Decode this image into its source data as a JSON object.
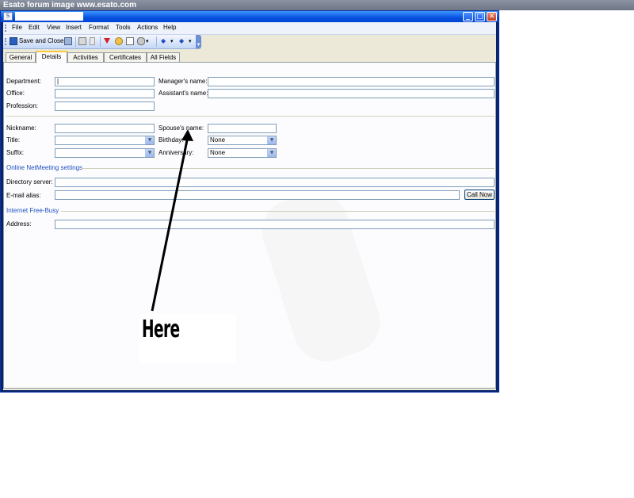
{
  "watermark": {
    "text": "Esato forum image www.esato.com"
  },
  "window": {
    "title_text": "",
    "controls": {
      "minimize": "_",
      "maximize": "□",
      "close": "✕"
    }
  },
  "menu": [
    "File",
    "Edit",
    "View",
    "Insert",
    "Format",
    "Tools",
    "Actions",
    "Help"
  ],
  "toolbar": {
    "save_close_label": "Save and Close"
  },
  "tabs": [
    "General",
    "Details",
    "Activities",
    "Certificates",
    "All Fields"
  ],
  "active_tab": "Details",
  "form": {
    "department_label": "Department:",
    "office_label": "Office:",
    "profession_label": "Profession:",
    "managers_name_label": "Manager's name:",
    "assistants_name_label": "Assistant's name:",
    "nickname_label": "Nickname:",
    "title_label": "Title:",
    "suffix_label": "Suffix:",
    "spouses_name_label": "Spouse's name:",
    "birthday_label": "Birthday:",
    "birthday_value": "None",
    "anniversary_label": "Anniversary:",
    "anniversary_value": "None",
    "netmeeting_section": "Online NetMeeting settings",
    "directory_server_label": "Directory server:",
    "email_alias_label": "E-mail alias:",
    "call_now_label": "Call Now",
    "free_busy_section": "Internet Free-Busy",
    "address_label": "Address:"
  },
  "annotation": {
    "text": "Here"
  }
}
